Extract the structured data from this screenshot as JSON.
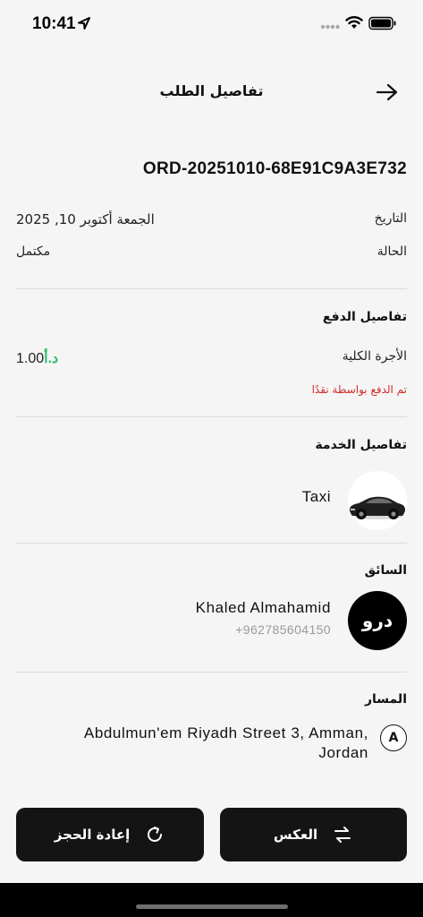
{
  "status_bar": {
    "time": "10:41"
  },
  "header": {
    "title": "تفاصيل الطلب"
  },
  "order": {
    "id": "ORD-20251010-68E91C9A3E732",
    "date_label": "التاريخ",
    "date_value": "الجمعة أكتوبر 10, 2025",
    "status_label": "الحالة",
    "status_value": "مكتمل"
  },
  "payment": {
    "title": "تفاصيل الدفع",
    "fare_label": "الأجرة الكلية",
    "fare_amount": "1.00",
    "fare_currency": "د.أ",
    "note": "تم الدفع بواسطة نقدًا"
  },
  "service": {
    "title": "تفاصيل الخدمة",
    "name": "Taxi"
  },
  "driver": {
    "title": "السائق",
    "name": "Khaled Almahamid",
    "phone": "+962785604150",
    "logo_text": "درو"
  },
  "route": {
    "title": "المسار",
    "marker": "A",
    "address": "Abdulmun'em Riyadh Street 3, Amman, Jordan"
  },
  "actions": {
    "rebook_label": "إعادة الحجز",
    "reverse_label": "العكس"
  },
  "colors": {
    "accent_green": "#2ebd6b",
    "alert_red": "#d22b2b",
    "button_bg": "#141414",
    "page_bg": "#f5f5f5"
  },
  "icons": {
    "back": "arrow-right-icon",
    "rebook": "refresh-icon",
    "reverse": "swap-icon"
  }
}
